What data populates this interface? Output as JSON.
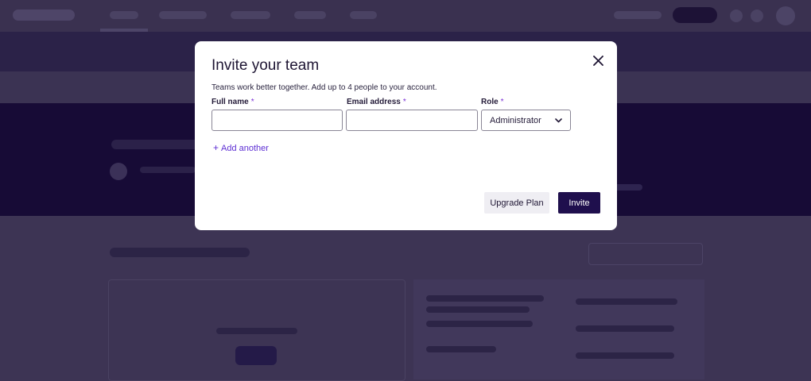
{
  "colors": {
    "accent": "#5d2ed3",
    "primary_button": "#1f0f4d",
    "required_marker": "#7a2fd6",
    "overlay": "#3d3454"
  },
  "modal": {
    "title": "Invite your team",
    "close_icon": "close-icon",
    "subtitle": "Teams work better together. Add up to 4 people to your account.",
    "fields": {
      "full_name": {
        "label": "Full name",
        "required_mark": "*",
        "value": ""
      },
      "email": {
        "label": "Email address",
        "required_mark": "*",
        "value": ""
      },
      "role": {
        "label": "Role",
        "required_mark": "*",
        "value": "Administrator",
        "icon": "chevron-down-icon"
      }
    },
    "add_another": {
      "icon": "plus-icon",
      "symbol": "+",
      "label": "Add another"
    },
    "buttons": {
      "upgrade": "Upgrade Plan",
      "invite": "Invite"
    }
  }
}
